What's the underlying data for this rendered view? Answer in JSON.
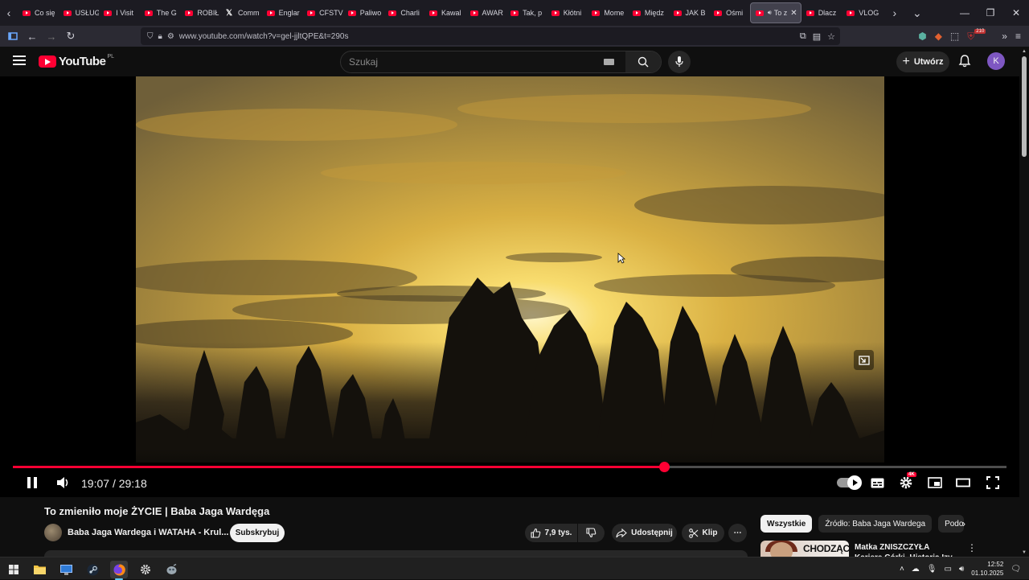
{
  "browser": {
    "tabs": [
      {
        "label": "Co się",
        "icon": "youtube-icon"
      },
      {
        "label": "USŁUG",
        "icon": "youtube-icon"
      },
      {
        "label": "I Visit",
        "icon": "youtube-icon"
      },
      {
        "label": "The G",
        "icon": "youtube-icon"
      },
      {
        "label": "ROBIŁ",
        "icon": "youtube-icon"
      },
      {
        "label": "Comm",
        "icon": "x-icon"
      },
      {
        "label": "Englar",
        "icon": "youtube-icon"
      },
      {
        "label": "CFSTV",
        "icon": "youtube-icon"
      },
      {
        "label": "Paliwo",
        "icon": "youtube-icon"
      },
      {
        "label": "Charli",
        "icon": "youtube-icon"
      },
      {
        "label": "Kawal",
        "icon": "youtube-icon"
      },
      {
        "label": "AWAR",
        "icon": "youtube-icon"
      },
      {
        "label": "Tak, p",
        "icon": "youtube-icon"
      },
      {
        "label": "Kłótni",
        "icon": "youtube-icon"
      },
      {
        "label": "Mome",
        "icon": "youtube-icon"
      },
      {
        "label": "Międz",
        "icon": "youtube-icon"
      },
      {
        "label": "JAK B",
        "icon": "youtube-icon"
      },
      {
        "label": "Ośmi",
        "icon": "youtube-icon"
      }
    ],
    "active_tab": {
      "label": "To z",
      "icon": "speaker-icon"
    },
    "tabs_after": [
      {
        "label": "Dlacz",
        "icon": "youtube-icon"
      },
      {
        "label": "VLOG",
        "icon": "youtube-icon"
      }
    ],
    "url": "www.youtube.com/watch?v=gel-jjltQPE&t=290s",
    "extensions_badge": "210"
  },
  "youtube": {
    "logo_text": "YouTube",
    "region": "PL",
    "search_placeholder": "Szukaj",
    "create_label": "Utwórz",
    "avatar_letter": "K"
  },
  "player": {
    "time_current": "19:07",
    "time_separator": "/",
    "time_total": "29:18",
    "progress": 0.655,
    "quality_badge": "4K"
  },
  "video": {
    "title": "To zmieniło moje ŻYCIE | Baba Jaga Wardęga",
    "channel": "Baba Jaga Wardega i WATAHA - Krul...",
    "subscribe_label": "Subskrybuj",
    "likes": "7,9 tys.",
    "share_label": "Udostępnij",
    "clip_label": "Klip"
  },
  "sidebar": {
    "chips": [
      "Wszystkie",
      "Źródło: Baba Jaga Wardega",
      "Podo"
    ],
    "recommendation": {
      "title": "Matka ZNISZCZYŁA Karierę Córki. Historia Izy Kisio",
      "thumb_text": "CHODZĄCA"
    }
  },
  "taskbar": {
    "time": "12:52",
    "date": "01.10.2025"
  },
  "colors": {
    "accent_red": "#ff0033",
    "background": "#0f0f0f",
    "sky_gold": "#f2c94c"
  }
}
